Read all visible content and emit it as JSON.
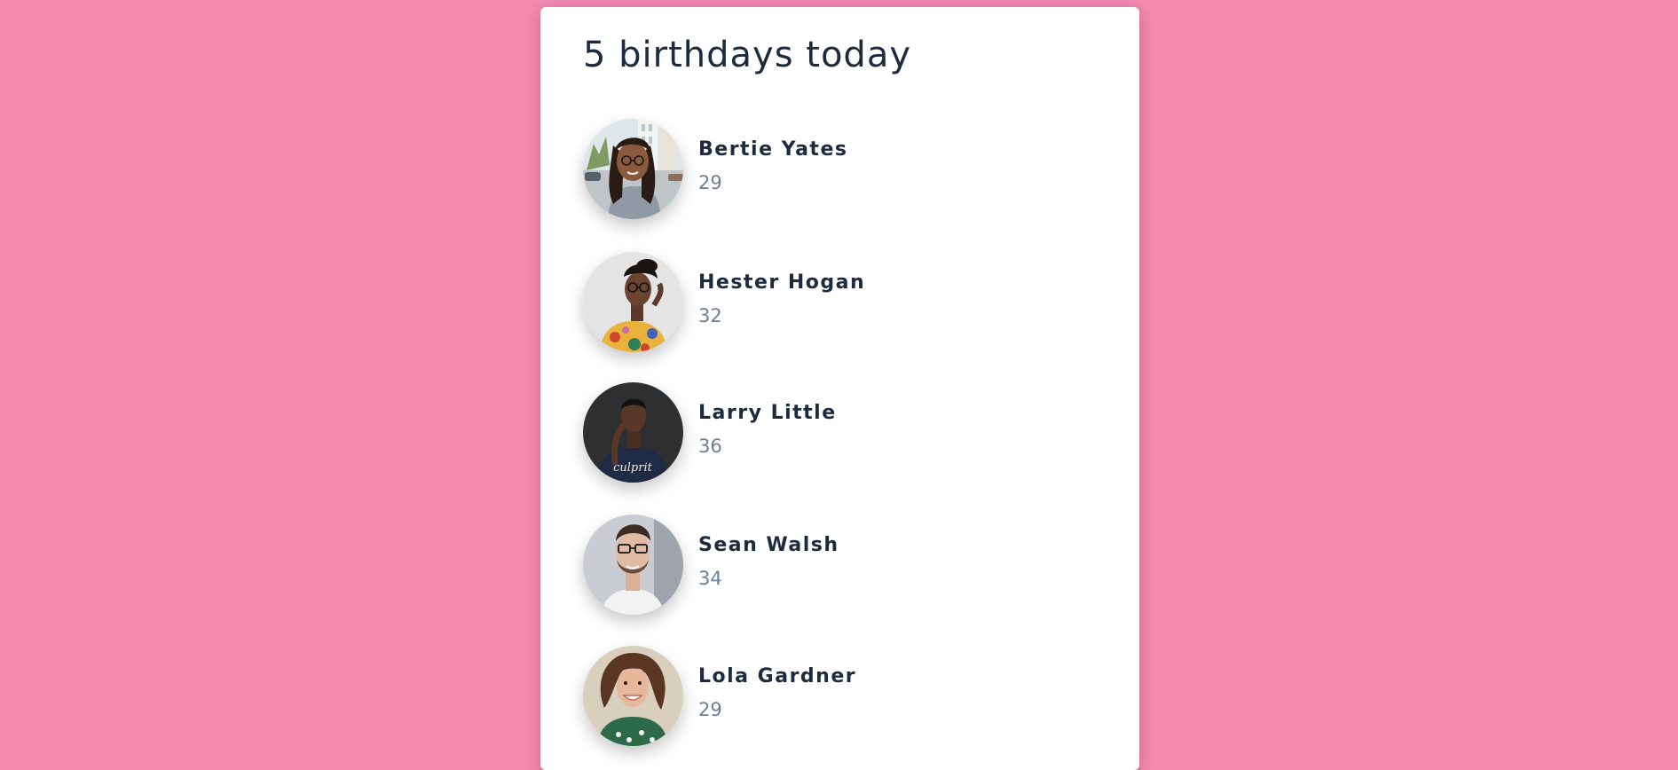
{
  "colors": {
    "page_background": "#f38bb0",
    "card_background": "#ffffff",
    "name_text": "#1c2b3e",
    "age_text": "#6c7f95"
  },
  "card": {
    "title": "5 birthdays today"
  },
  "people": [
    {
      "name": "Bertie Yates",
      "age": "29",
      "avatar_icon": "woman-with-glasses-street-photo"
    },
    {
      "name": "Hester Hogan",
      "age": "32",
      "avatar_icon": "woman-with-glasses-floral-shirt-photo"
    },
    {
      "name": "Larry Little",
      "age": "36",
      "avatar_icon": "man-dark-shirt-photo"
    },
    {
      "name": "Sean Walsh",
      "age": "34",
      "avatar_icon": "man-with-glasses-beard-photo"
    },
    {
      "name": "Lola Gardner",
      "age": "29",
      "avatar_icon": "smiling-woman-curly-hair-photo"
    }
  ]
}
